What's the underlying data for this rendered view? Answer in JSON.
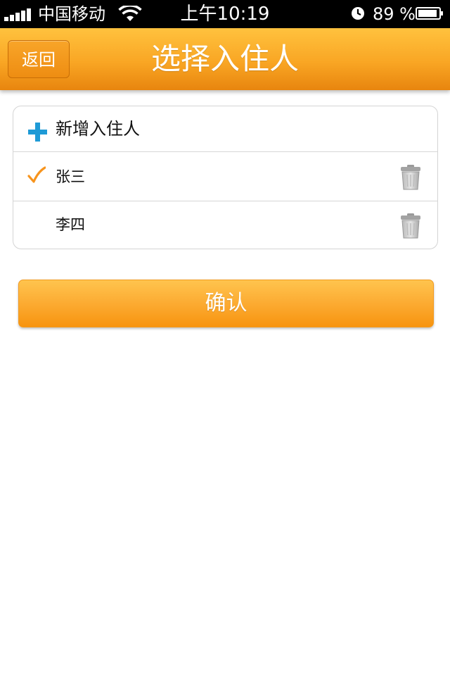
{
  "status_bar": {
    "carrier": "中国移动",
    "time": "上午10:19",
    "battery_percent": "89 %",
    "icons": [
      "signal-icon",
      "wifi-icon",
      "alarm-icon",
      "battery-icon"
    ]
  },
  "nav": {
    "back_label": "返回",
    "title": "选择入住人"
  },
  "guests": {
    "add_label": "新增入住人",
    "items": [
      {
        "name": "张三",
        "selected": true
      },
      {
        "name": "李四",
        "selected": false
      }
    ]
  },
  "confirm_label": "确认",
  "colors": {
    "accent_orange": "#f9a624",
    "plus_blue": "#1e9ad6",
    "check_orange": "#f7941d"
  }
}
